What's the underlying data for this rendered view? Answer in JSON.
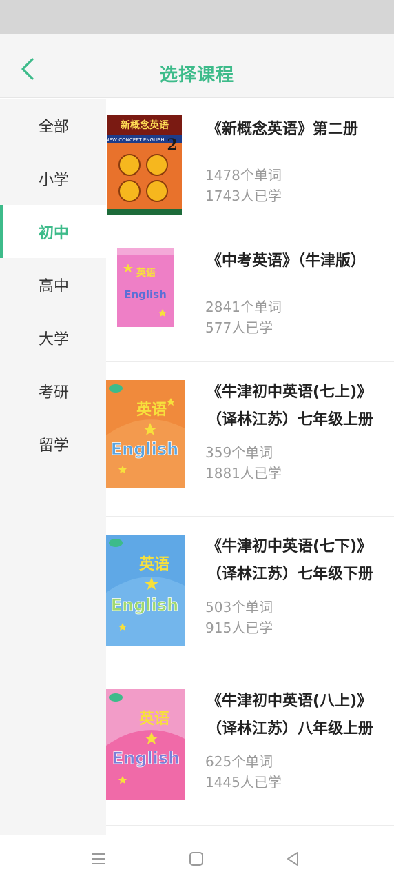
{
  "header": {
    "title": "选择课程"
  },
  "sidebar": {
    "items": [
      {
        "label": "全部"
      },
      {
        "label": "小学"
      },
      {
        "label": "初中"
      },
      {
        "label": "高中"
      },
      {
        "label": "大学"
      },
      {
        "label": "考研"
      },
      {
        "label": "留学"
      }
    ]
  },
  "courses": [
    {
      "title": "《新概念英语》第二册",
      "words": "1478个单词",
      "learners": "1743人已学",
      "cover_text": "新概念英语",
      "cover_sub": "NEW CONCEPT ENGLISH",
      "cover_num": "2"
    },
    {
      "title": "《中考英语》（牛津版）",
      "words": "2841个单词",
      "learners": "577人已学",
      "cover_text": "英语",
      "cover_sub": "English"
    },
    {
      "title_line1": "《牛津初中英语(七上)》",
      "title_line2": "（译林江苏）七年级上册",
      "words": "359个单词",
      "learners": "1881人已学",
      "cover_text": "英语",
      "cover_sub": "English"
    },
    {
      "title_line1": "《牛津初中英语(七下)》",
      "title_line2": "（译林江苏）七年级下册",
      "words": "503个单词",
      "learners": "915人已学",
      "cover_text": "英语",
      "cover_sub": "English"
    },
    {
      "title_line1": "《牛津初中英语(八上)》",
      "title_line2": "（译林江苏）八年级上册",
      "words": "625个单词",
      "learners": "1445人已学",
      "cover_text": "英语",
      "cover_sub": "English"
    }
  ],
  "colors": {
    "accent": "#3dbb8a",
    "cover_orange": "#f08a3c",
    "cover_pink": "#ee7fc6",
    "cover_blue": "#5fa8e6"
  },
  "icons": {
    "back": "chevron-left-icon",
    "menu": "menu-icon",
    "home": "square-icon",
    "back_nav": "triangle-back-icon"
  }
}
